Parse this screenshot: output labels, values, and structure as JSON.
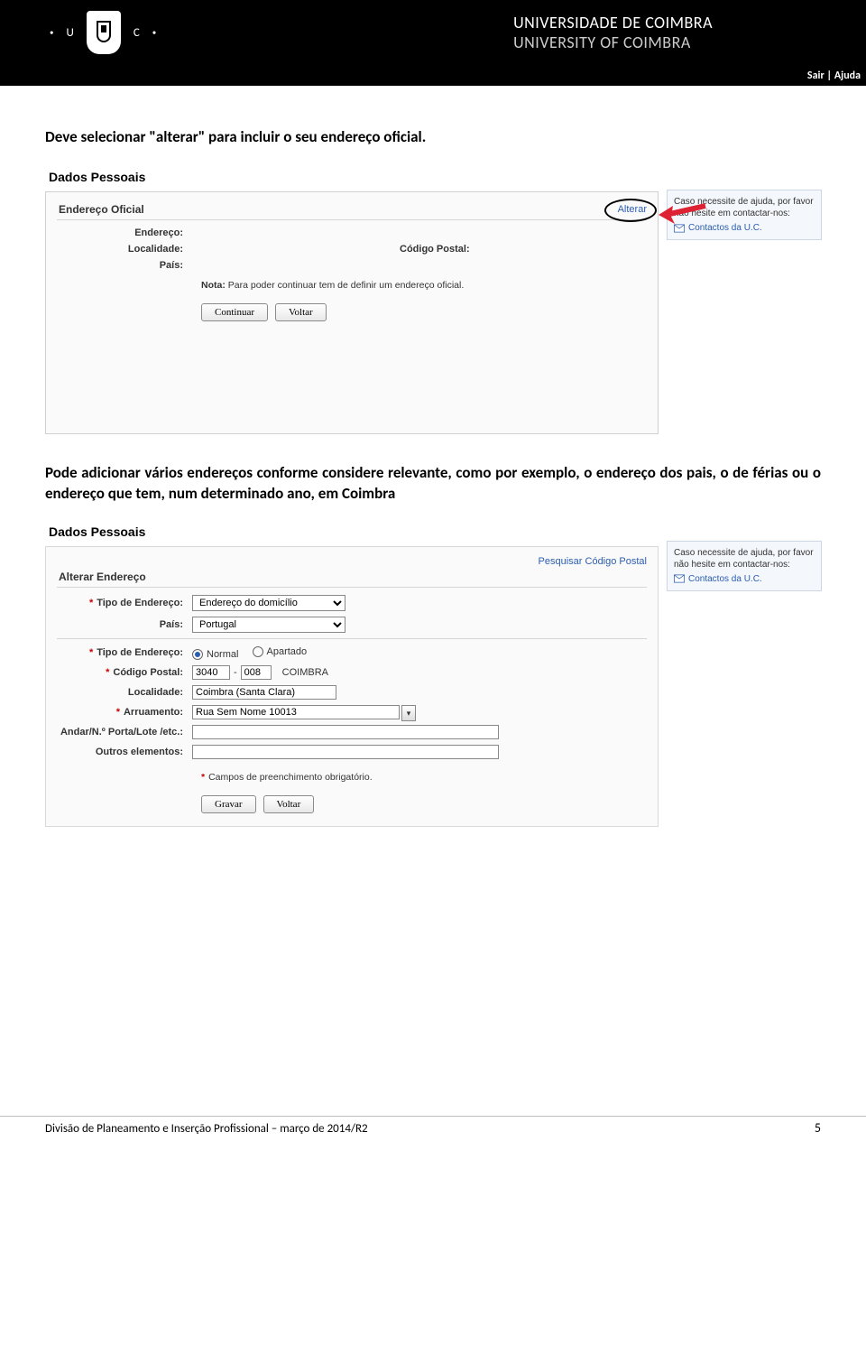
{
  "header": {
    "uni_pt": "UNIVERSIDADE DE COIMBRA",
    "uni_en": "UNIVERSITY OF COIMBRA",
    "letter_u": "U",
    "letter_c": "C",
    "sair": "Sair",
    "sep": " | ",
    "ajuda": "Ajuda"
  },
  "text": {
    "instruction1": "Deve selecionar \"alterar\" para incluir o seu endereço oficial.",
    "instruction2": "Pode adicionar vários endereços conforme considere relevante, como por exemplo, o endereço dos pais, o de férias ou o endereço que tem, num determinado ano, em Coimbra"
  },
  "panel1": {
    "title": "Dados Pessoais",
    "section": "Endereço Oficial",
    "alterar": "Alterar",
    "labels": {
      "endereco": "Endereço:",
      "localidade": "Localidade:",
      "codigo_postal": "Código Postal:",
      "pais": "País:"
    },
    "note_label": "Nota:",
    "note_text": " Para poder continuar tem de definir um endereço oficial.",
    "btn_continuar": "Continuar",
    "btn_voltar": "Voltar",
    "help_text": "Caso necessite de ajuda, por favor não hesite em contactar-nos:",
    "help_link": "Contactos da U.C."
  },
  "panel2": {
    "title": "Dados Pessoais",
    "search_cp": "Pesquisar Código Postal",
    "section": "Alterar Endereço",
    "help_text": "Caso necessite de ajuda, por favor não hesite em contactar-nos:",
    "help_link": "Contactos da U.C.",
    "labels": {
      "tipo_endereco": "Tipo de Endereço:",
      "pais": "País:",
      "tipo_endereco2": "Tipo de Endereço:",
      "codigo_postal": "Código Postal:",
      "localidade": "Localidade:",
      "arruamento": "Arruamento:",
      "andar": "Andar/N.º Porta/Lote /etc.:",
      "outros": "Outros elementos:"
    },
    "values": {
      "tipo_endereco": "Endereço do domicílio",
      "pais": "Portugal",
      "radio_normal": "Normal",
      "radio_apartado": "Apartado",
      "cp1": "3040",
      "cp_dash": "-",
      "cp2": "008",
      "cp_city": "COIMBRA",
      "localidade": "Coimbra (Santa Clara)",
      "arruamento": "Rua Sem Nome 10013",
      "andar": "",
      "outros": ""
    },
    "req_note": "Campos de preenchimento obrigatório.",
    "btn_gravar": "Gravar",
    "btn_voltar": "Voltar"
  },
  "footer": {
    "text": "Divisão de Planeamento e Inserção Profissional – março de 2014/R2",
    "page": "5"
  }
}
